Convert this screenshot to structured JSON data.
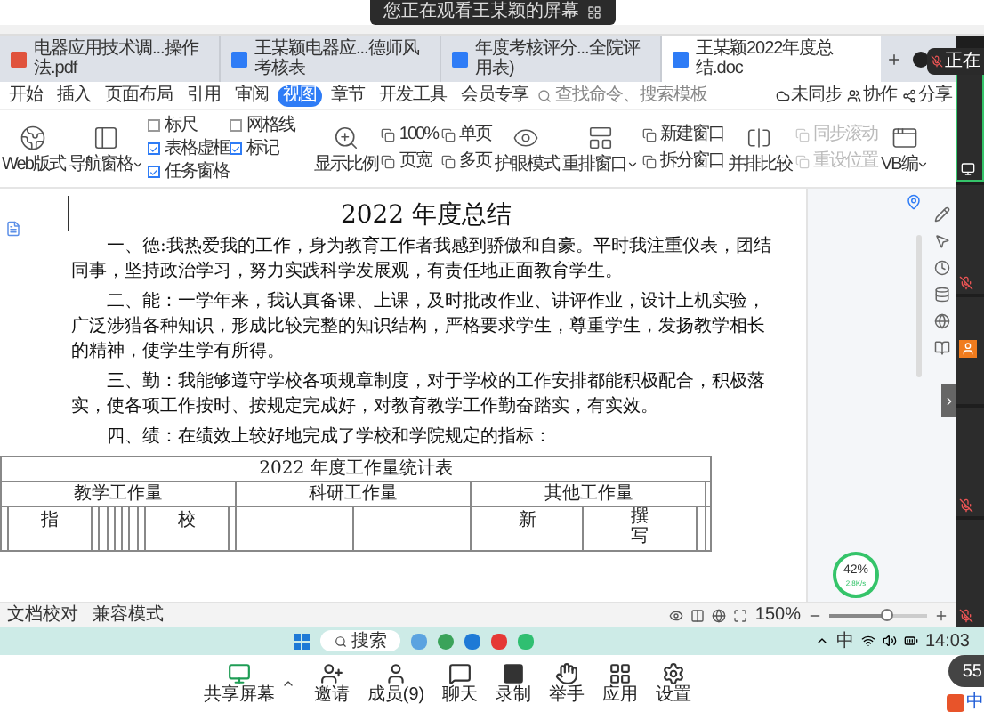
{
  "share_banner": {
    "text": "您正在观看王某颖的屏幕"
  },
  "tabs": [
    {
      "label": "电器应用技术调...操作法.pdf",
      "kind": "pdf",
      "selected": false
    },
    {
      "label": "王某颖电器应...德师风考核表",
      "kind": "doc",
      "selected": false
    },
    {
      "label": "年度考核评分...全院评用表)",
      "kind": "doc",
      "selected": false
    },
    {
      "label": "王某颖2022年度总结.doc",
      "kind": "doc",
      "selected": true
    }
  ],
  "menu": [
    {
      "label": "开始",
      "selected": false
    },
    {
      "label": "插入",
      "selected": false
    },
    {
      "label": "页面布局",
      "selected": false
    },
    {
      "label": "引用",
      "selected": false
    },
    {
      "label": "审阅",
      "selected": false
    },
    {
      "label": "视图",
      "selected": true
    },
    {
      "label": "章节",
      "selected": false
    },
    {
      "label": "开发工具",
      "selected": false
    },
    {
      "label": "会员专享",
      "selected": false
    }
  ],
  "command_search": {
    "placeholder": "查找命令、搜索模板"
  },
  "menu_actions": [
    {
      "label": "未同步",
      "kind": "sync"
    },
    {
      "label": "协作",
      "kind": "collab"
    },
    {
      "label": "分享",
      "kind": "share"
    }
  ],
  "ribbon": [
    {
      "kind": "large",
      "label": "Web版式",
      "caret": false
    },
    {
      "kind": "large",
      "label": "导航窗格",
      "caret": true
    },
    {
      "kind": "checks",
      "items": [
        {
          "label": "标尺",
          "checked": false
        },
        {
          "label": "网格线",
          "checked": false
        },
        {
          "label": "表格虚框",
          "checked": true
        },
        {
          "label": "标记",
          "checked": true
        },
        {
          "label": "任务窗格",
          "checked": true
        }
      ]
    },
    {
      "kind": "large",
      "label": "显示比例",
      "caret": false
    },
    {
      "kind": "small",
      "items": [
        {
          "label": "100%",
          "disabled": false
        },
        {
          "label": "页宽",
          "disabled": false
        }
      ]
    },
    {
      "kind": "small",
      "items": [
        {
          "label": "单页",
          "disabled": false
        },
        {
          "label": "多页",
          "disabled": false
        }
      ]
    },
    {
      "kind": "large",
      "label": "护眼模式",
      "caret": false
    },
    {
      "kind": "large",
      "label": "重排窗口",
      "caret": true
    },
    {
      "kind": "small",
      "items": [
        {
          "label": "新建窗口",
          "disabled": false
        },
        {
          "label": "拆分窗口",
          "disabled": false
        }
      ]
    },
    {
      "kind": "large",
      "label": "并排比较",
      "caret": false
    },
    {
      "kind": "small",
      "items": [
        {
          "label": "同步滚动",
          "disabled": true
        },
        {
          "label": "重设位置",
          "disabled": true
        }
      ]
    },
    {
      "kind": "large",
      "label": "VB编",
      "caret": true
    }
  ],
  "document": {
    "title": "2022 年度总结",
    "paragraphs": [
      "一、德:我热爱我的工作，身为教育工作者我感到骄傲和自豪。平时我注重仪表，团结同事，坚持政治学习，努力实践科学发展观，有责任地正面教育学生。",
      "二、能：一学年来，我认真备课、上课，及时批改作业、讲评作业，设计上机实验，广泛涉猎各种知识，形成比较完整的知识结构，严格要求学生，尊重学生，发扬教学相长的精神，使学生学有所得。",
      "三、勤：我能够遵守学校各项规章制度，对于学校的工作安排都能积极配合，积极落实，使各项工作按时、按规定完成好，对教育教学工作勤奋踏实，有实效。",
      "四、绩：在绩效上较好地完成了学校和学院规定的指标："
    ],
    "table": {
      "title": "2022 年度工作量统计表",
      "groups": [
        "教学工作量",
        "科研工作量",
        "其他工作量"
      ],
      "row_3": [
        "指",
        "校",
        "新",
        "撰写"
      ]
    }
  },
  "status_bar": {
    "items": [
      "文档校对",
      "兼容模式"
    ],
    "zoom": "150%",
    "zoom_slider": {
      "level": 0.58
    }
  },
  "taskbar": {
    "search": "搜索",
    "ime": "中",
    "time": "14:03"
  },
  "meeting_toolbar": [
    {
      "label": "共享屏幕",
      "kind": "share"
    },
    {
      "label": "邀请",
      "kind": "invite"
    },
    {
      "label": "成员(9)",
      "kind": "members"
    },
    {
      "label": "聊天",
      "kind": "chat"
    },
    {
      "label": "录制",
      "kind": "record"
    },
    {
      "label": "举手",
      "kind": "hand"
    },
    {
      "label": "应用",
      "kind": "apps"
    },
    {
      "label": "设置",
      "kind": "settings"
    }
  ],
  "video_tiles": [
    {
      "kind": "screen"
    },
    {
      "kind": "muted"
    },
    {
      "kind": "avatar"
    },
    {
      "kind": "muted"
    },
    {
      "kind": "muted"
    }
  ],
  "speaker_badge": "正在",
  "network": {
    "percent": "42%",
    "speed": "2.8K/s"
  },
  "participant_badge": "55",
  "ime_indicator": "中"
}
